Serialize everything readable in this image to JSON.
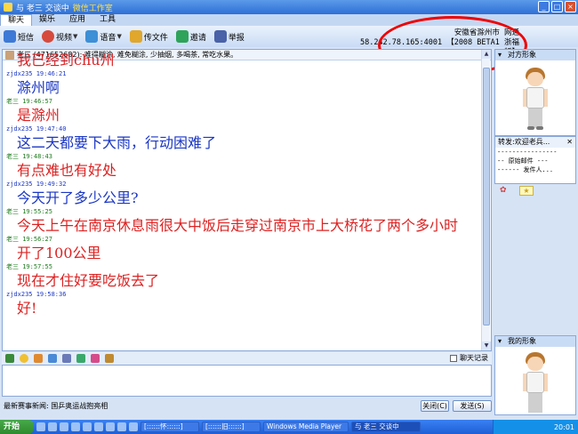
{
  "window": {
    "title": "与 老三 交谈中",
    "title_highlight": "微信工作室",
    "buttons": [
      "_",
      "□",
      "×"
    ]
  },
  "tabs": [
    "聊天",
    "娱乐",
    "应用",
    "工具"
  ],
  "toolbar": [
    {
      "label": "短信",
      "color": "#3d79d6"
    },
    {
      "label": "视频",
      "color": "#d64b3d"
    },
    {
      "label": "语音",
      "color": "#3d8fd6"
    },
    {
      "label": "传文件",
      "color": "#e0a72c"
    },
    {
      "label": "邀请",
      "color": "#2fa35a"
    },
    {
      "label": "举报",
      "color": "#4a62a8"
    }
  ],
  "location": {
    "line1": "安徽省滁州市 网通",
    "line2": "58.242.78.165:4001 【2008 BETA1 浙福版】"
  },
  "notice": "老三 (471652682): 难得糊涂, 难免糊涂, 少抽烟, 多喝茶, 常吃水果。",
  "messages": [
    {
      "meta": "",
      "text": "我已经到chu州",
      "who": "peer"
    },
    {
      "meta": "zjdx235 19:46:21",
      "text": "滁州啊",
      "who": "me"
    },
    {
      "meta": "老三 19:46:57",
      "text": "是滁州",
      "who": "peer"
    },
    {
      "meta": "zjdx235 19:47:40",
      "text": "这二天都要下大雨，行动困难了",
      "who": "me"
    },
    {
      "meta": "老三 19:48:43",
      "text": "有点难也有好处",
      "who": "peer"
    },
    {
      "meta": "zjdx235 19:49:32",
      "text": "今天开了多少公里?",
      "who": "me"
    },
    {
      "meta": "老三 19:55:25",
      "text": "今天上午在南京休息雨很大中饭后走穿过南京市上大桥花了两个多小时",
      "who": "peer"
    },
    {
      "meta": "老三 19:56:27",
      "text": "开了100公里",
      "who": "peer"
    },
    {
      "meta": "老三 19:57:55",
      "text": "现在才住好要吃饭去了",
      "who": "peer"
    },
    {
      "meta": "zjdx235 19:58:36",
      "text": "好!",
      "who": "me"
    }
  ],
  "history_label": "聊天记录",
  "news": "最新赛事新闻: 国乒奥运战抱亮相",
  "close_button": "关闭(C)",
  "send_button": "发送(S)",
  "right": {
    "peer_header": "对方形象",
    "forward_title": "转发:欢迎老兵...",
    "forward_lines": [
      "----------------",
      "-- 原始邮件 ---",
      "------ 发件人..."
    ],
    "my_header": "我的形象"
  },
  "taskbar": {
    "start": "开始",
    "tasks": [
      "[::::::怀::::::]",
      "[::::::旧::::::]",
      "Windows Media Player",
      "与 老三 交谈中"
    ],
    "clock": "20:01"
  }
}
